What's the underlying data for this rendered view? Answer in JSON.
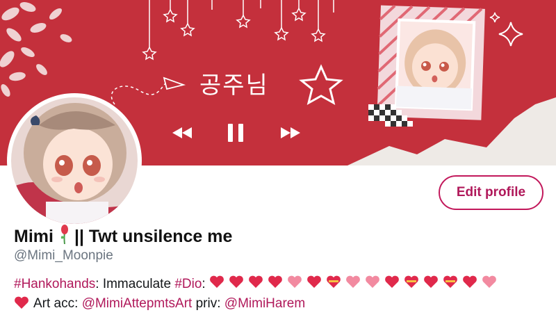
{
  "banner": {
    "korean_text": "공주님"
  },
  "profile": {
    "display_name_first": "Mimi",
    "display_name_rest": "|| Twt unsilence me",
    "handle": "@Mimi_Moonpie",
    "edit_label": "Edit profile"
  },
  "bio": {
    "tag1": "#Hankohands",
    "text1": ": Immaculate ",
    "tag2": "#Dio",
    "text2": ":",
    "text3": "Art acc: ",
    "mention1": "@MimiAttepmtsArt",
    "text4": " priv: ",
    "mention2": "@MimiHarem"
  },
  "icons": {
    "controls": [
      "rewind-icon",
      "pause-icon",
      "fast-forward-icon"
    ],
    "decor": [
      "star-icon",
      "paper-plane-icon",
      "sparkle-icon"
    ]
  },
  "colors": {
    "banner": "#c8323e",
    "accent": "#b0185a",
    "handle": "#6b7580"
  }
}
